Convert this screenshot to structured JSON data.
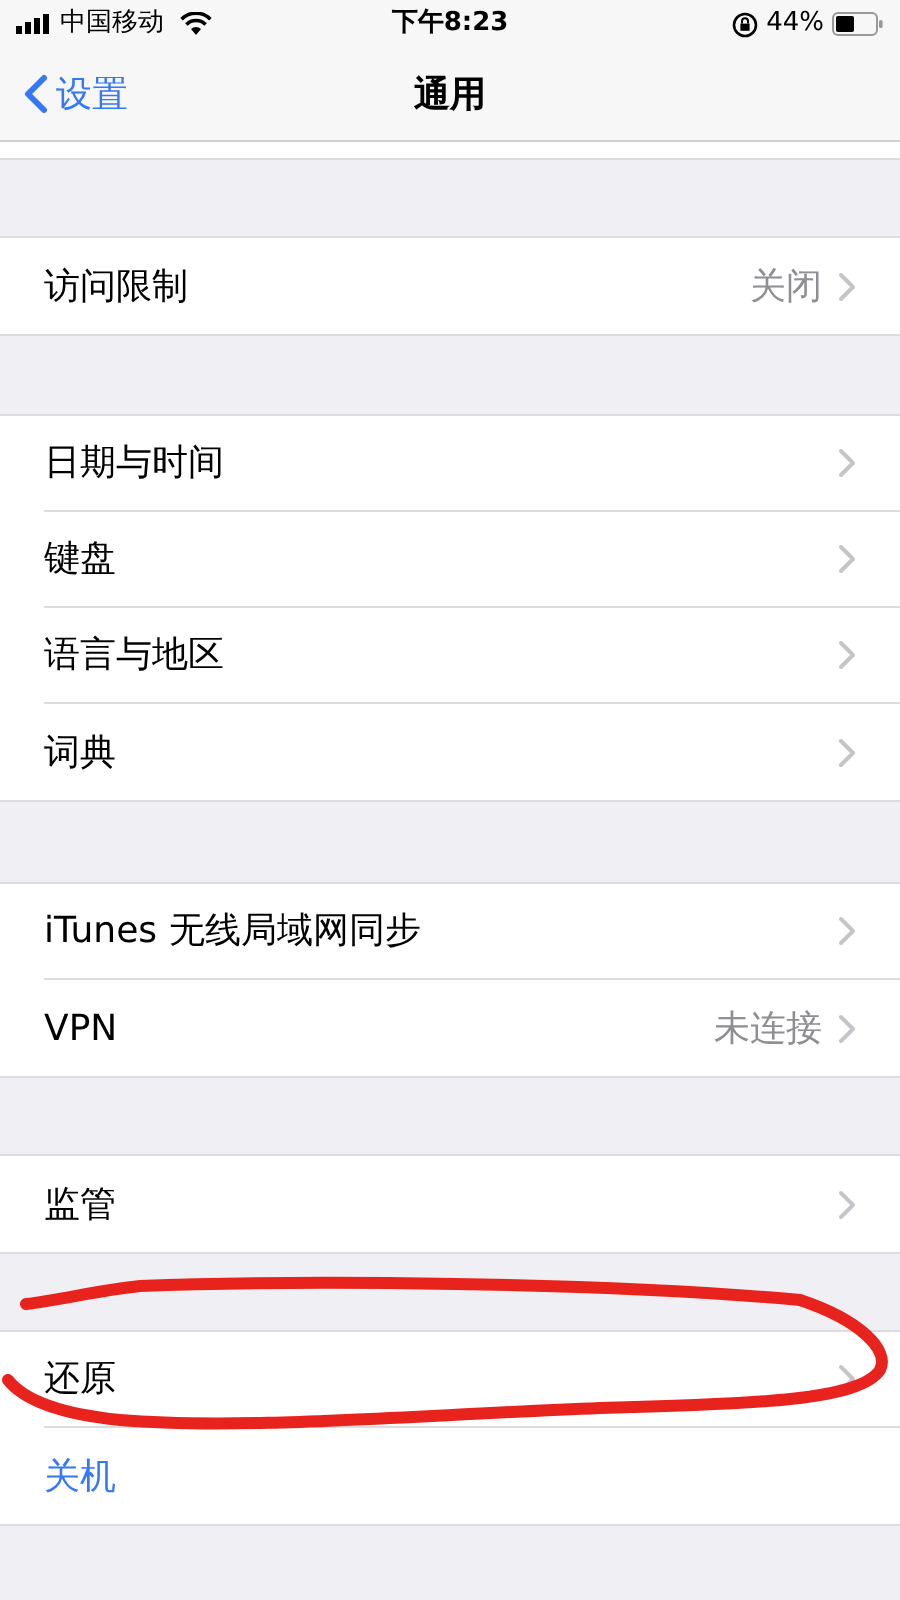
{
  "status_bar": {
    "carrier": "中国移动",
    "time": "下午8:23",
    "battery": "44%"
  },
  "nav": {
    "back": "设置",
    "title": "通用"
  },
  "groups": [
    {
      "rows": [
        {
          "kind": "link",
          "label": "访问限制",
          "value": "关闭"
        }
      ]
    },
    {
      "rows": [
        {
          "kind": "link",
          "label": "日期与时间"
        },
        {
          "kind": "link",
          "label": "键盘"
        },
        {
          "kind": "link",
          "label": "语言与地区"
        },
        {
          "kind": "link",
          "label": "词典"
        }
      ]
    },
    {
      "rows": [
        {
          "kind": "link",
          "label": "iTunes 无线局域网同步"
        },
        {
          "kind": "link",
          "label": "VPN",
          "value": "未连接"
        }
      ]
    },
    {
      "rows": [
        {
          "kind": "link",
          "label": "监管"
        }
      ]
    },
    {
      "rows": [
        {
          "kind": "link",
          "label": "还原"
        },
        {
          "kind": "action",
          "label": "关机"
        }
      ]
    }
  ],
  "markup": {
    "kind": "freehand-loop",
    "color": "#e8231d"
  }
}
